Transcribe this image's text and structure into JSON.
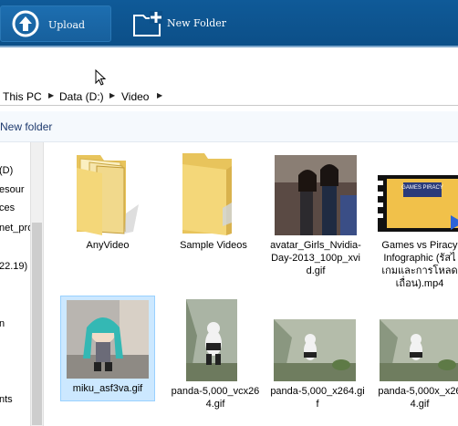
{
  "toolbar": {
    "upload_label": "Upload",
    "new_folder_label": "New Folder",
    "upload_icon": "upload-arrow-icon",
    "new_folder_icon": "new-folder-icon"
  },
  "breadcrumb": [
    "This PC",
    "Data (D:)",
    "Video"
  ],
  "command_bar": {
    "new_folder_label": "New folder"
  },
  "nav_pane": {
    "items": [
      "(D)",
      "esour",
      "ces",
      "net_pro",
      "22.19)",
      "n",
      "nts"
    ]
  },
  "files": [
    {
      "name": "AnyVideo",
      "type": "folder"
    },
    {
      "name": "Sample Videos",
      "type": "folder"
    },
    {
      "name": "avatar_Girls_Nvidia-Day-2013_100p_xvid.gif",
      "type": "image"
    },
    {
      "name": "Games vs Piracy Infographic (รัสไ เกมและการโหลด เถื่อน).mp4",
      "type": "video",
      "thumb_text": "GAMES PIRACY"
    },
    {
      "name": "miku_asf3va.gif",
      "type": "image",
      "selected": true
    },
    {
      "name": "panda-5,000_vcx264.gif",
      "type": "image"
    },
    {
      "name": "panda-5,000_x264.gif",
      "type": "image"
    },
    {
      "name": "panda-5,000x_x264.gif",
      "type": "image"
    }
  ],
  "colors": {
    "toolbar_bg": "#0c4f88",
    "selection_bg": "#cce8ff",
    "command_text": "#1e3a6e"
  }
}
